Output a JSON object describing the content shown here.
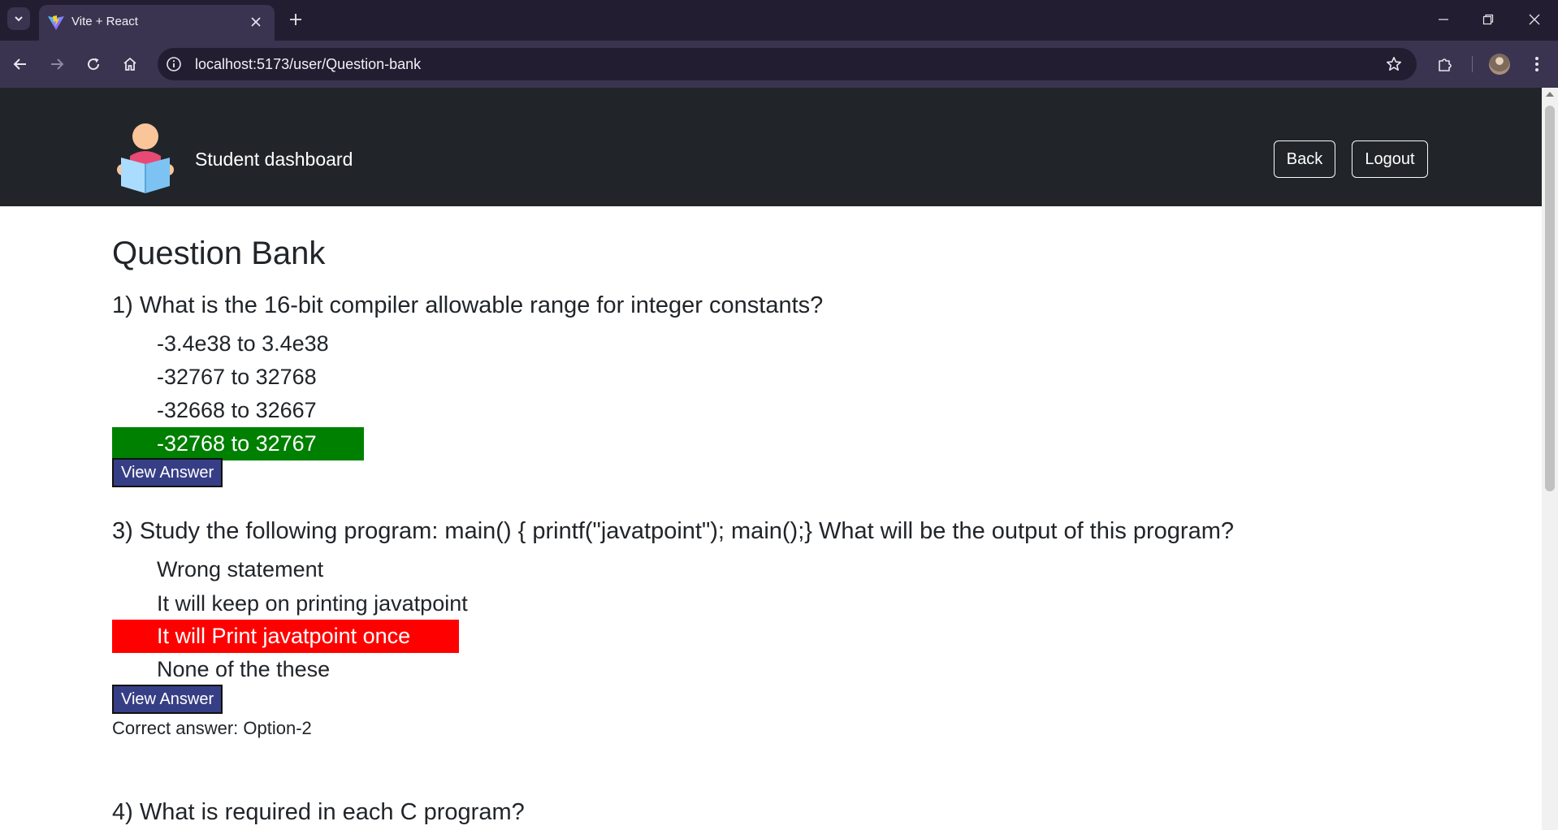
{
  "browser": {
    "tab_title": "Vite + React",
    "url": "localhost:5173/user/Question-bank",
    "icons": {
      "tab_list": "chevron-down-icon",
      "tab_close": "close-icon",
      "new_tab": "plus-icon",
      "minimize": "minimize-icon",
      "restore": "restore-icon",
      "close_window": "close-icon",
      "back": "arrow-left-icon",
      "forward": "arrow-right-icon",
      "reload": "reload-icon",
      "home": "home-icon",
      "site_info": "info-icon",
      "bookmark": "star-icon",
      "extensions": "puzzle-icon",
      "menu": "kebab-menu-icon"
    }
  },
  "navbar": {
    "brand": "Student dashboard",
    "back_label": "Back",
    "logout_label": "Logout"
  },
  "page": {
    "title": "Question Bank",
    "questions": [
      {
        "text": "1) What is the 16-bit compiler allowable range for integer constants?",
        "options": [
          {
            "text": "-3.4e38 to 3.4e38",
            "state": "normal"
          },
          {
            "text": "-32767 to 32768",
            "state": "normal"
          },
          {
            "text": "-32668 to 32667",
            "state": "normal"
          },
          {
            "text": "-32768 to 32767",
            "state": "correct"
          }
        ],
        "view_answer_label": "View Answer"
      },
      {
        "text": "3) Study the following program: main() { printf(\"javatpoint\"); main();} What will be the output of this program?",
        "options": [
          {
            "text": "Wrong statement",
            "state": "normal"
          },
          {
            "text": "It will keep on printing javatpoint",
            "state": "normal"
          },
          {
            "text": "It will Print javatpoint once",
            "state": "wrong"
          },
          {
            "text": "None of the these",
            "state": "normal"
          }
        ],
        "view_answer_label": "View Answer",
        "correct_answer": "Correct answer: Option-2"
      },
      {
        "text": "4) What is required in each C program?"
      }
    ]
  },
  "colors": {
    "navbar_bg": "#212529",
    "correct_option": "#008000",
    "wrong_option": "#ff0000",
    "view_answer_button": "#363f85"
  }
}
